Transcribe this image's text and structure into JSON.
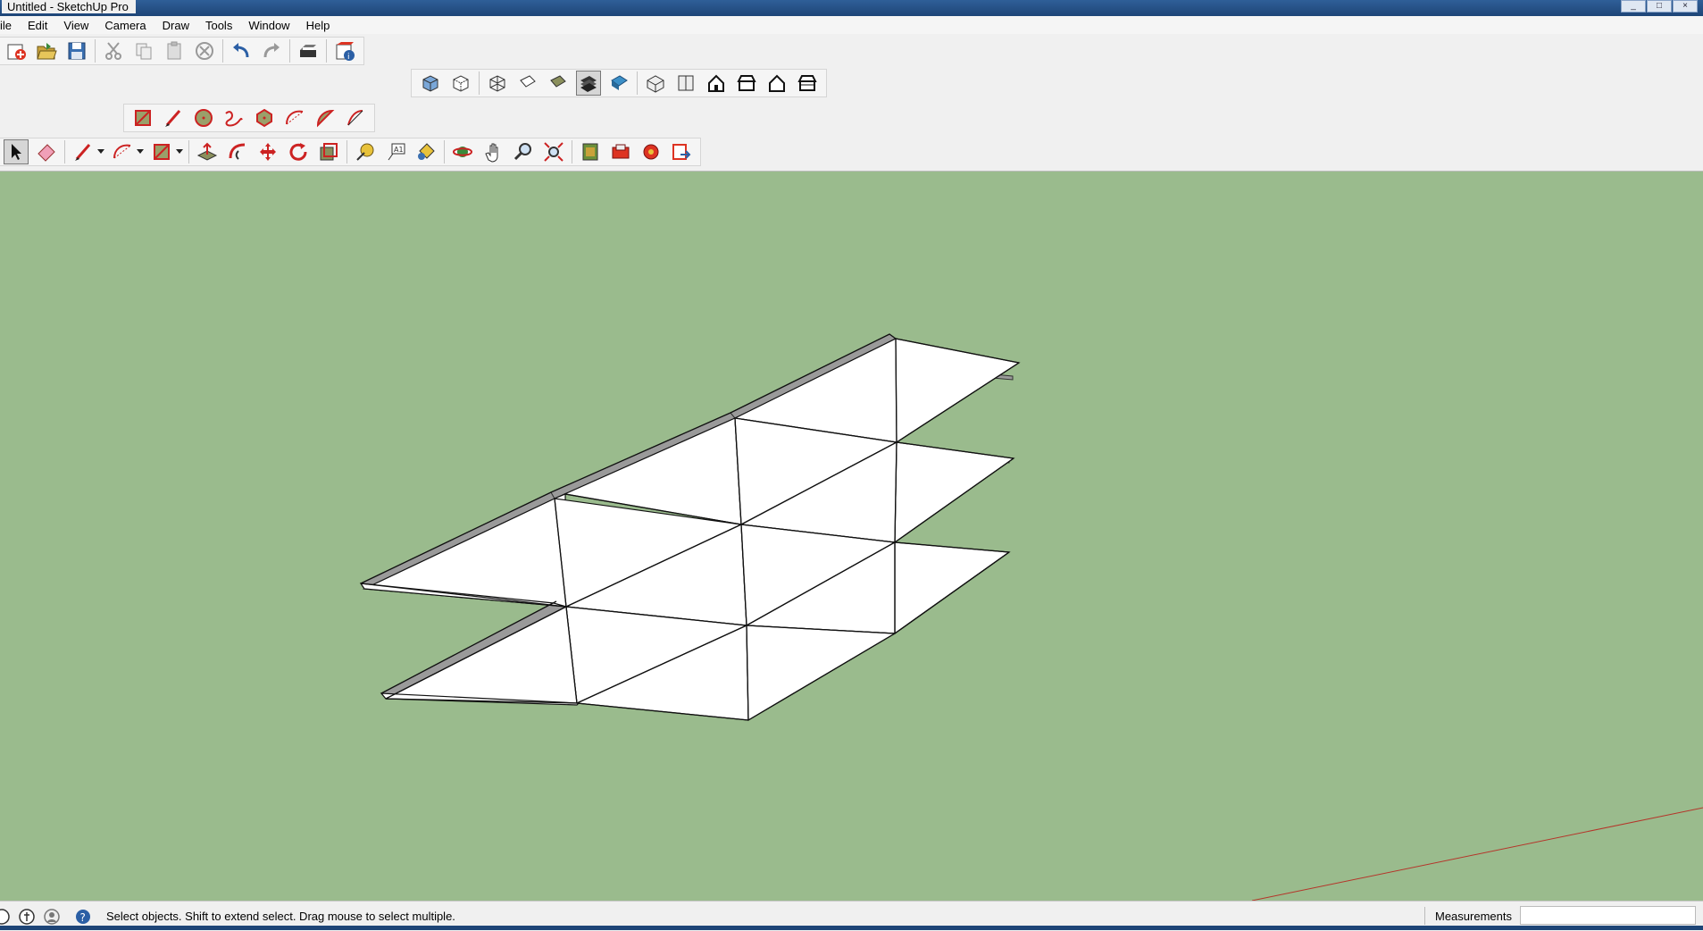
{
  "window": {
    "title": "Untitled - SketchUp Pro",
    "controls": [
      "_",
      "□",
      "×"
    ]
  },
  "menu": {
    "items": [
      "ile",
      "Edit",
      "View",
      "Camera",
      "Draw",
      "Tools",
      "Window",
      "Help"
    ]
  },
  "toolbars": {
    "standard": [
      "new-icon",
      "open-icon",
      "save-icon",
      "cut-icon",
      "copy-icon",
      "paste-icon",
      "erase-icon",
      "undo-icon",
      "redo-icon",
      "print-icon",
      "model-info-icon"
    ],
    "face_style": [
      "xray-icon",
      "back-edges-icon",
      "wireframe-icon",
      "hidden-line-icon",
      "shaded-icon",
      "shaded-textures-icon",
      "monochrome-icon"
    ],
    "face_style_selected": "shaded-textures-icon",
    "views": [
      "iso-view-icon",
      "top-view-icon",
      "front-view-icon",
      "right-view-icon",
      "back-view-icon",
      "left-view-icon"
    ],
    "drawing": [
      "rectangle-icon",
      "line-icon",
      "circle-icon",
      "freehand-icon",
      "polygon-icon",
      "arc-icon",
      "pie-icon",
      "two-point-arc-icon"
    ],
    "main": [
      "select-icon",
      "eraser-icon",
      "pencil-icon",
      "arc-tool-icon",
      "shape-icon",
      "pushpull-icon",
      "followme-icon",
      "move-icon",
      "rotate-icon",
      "scale-icon",
      "tape-measure-icon",
      "text-icon",
      "paint-bucket-icon",
      "orbit-icon",
      "pan-icon",
      "zoom-icon",
      "zoom-extents-icon",
      "3d-warehouse-icon",
      "extension-warehouse-icon",
      "layout-icon",
      "send-to-layout-icon"
    ]
  },
  "viewport": {
    "background": "#9abb8d",
    "model_face_color": "#ffffff",
    "edge_color": "#000000",
    "axis_color": "#b5352a"
  },
  "status": {
    "hint": "Select objects. Shift to extend select. Drag mouse to select multiple.",
    "measurements_label": "Measurements",
    "measurements_value": ""
  }
}
